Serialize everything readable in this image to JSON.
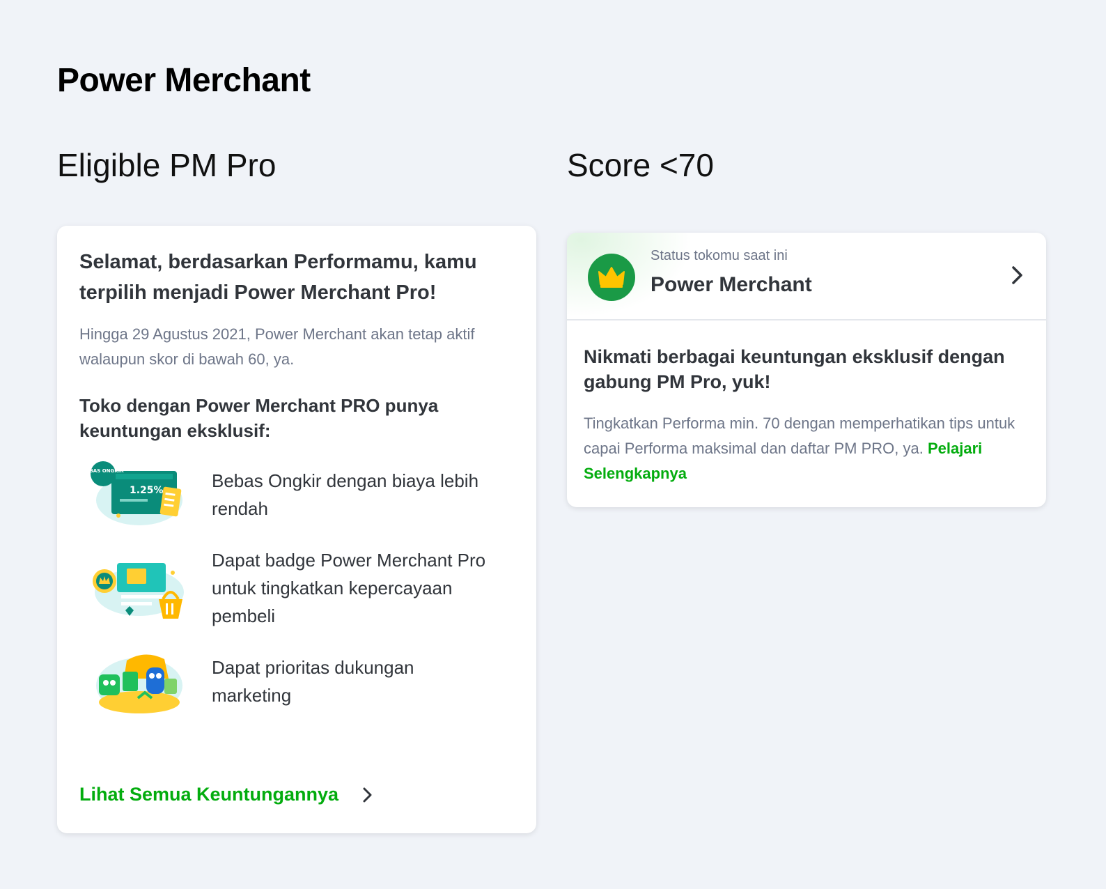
{
  "page_title": "Power Merchant",
  "columns": {
    "left_heading": "Eligible PM Pro",
    "right_heading": "Score <70"
  },
  "eligible_card": {
    "title": "Selamat, berdasarkan Performamu, kamu terpilih menjadi Power Merchant Pro!",
    "subtitle": "Hingga 29 Agustus 2021, Power Merchant akan tetap aktif walaupun skor di bawah 60, ya.",
    "benefits_heading": "Toko dengan Power Merchant PRO punya keuntungan eksklusif:",
    "benefits": [
      {
        "icon": "free-shipping-illustration",
        "text": "Bebas Ongkir dengan biaya lebih rendah",
        "badge_text": "BEBAS ONGKIR",
        "badge_value": "1.25%"
      },
      {
        "icon": "shop-badge-illustration",
        "text": "Dapat badge Power Merchant Pro untuk tingkatkan kepercayaan pembeli"
      },
      {
        "icon": "marketing-priority-illustration",
        "text": "Dapat prioritas dukungan marketing"
      }
    ],
    "see_all_label": "Lihat Semua Keuntungannya"
  },
  "score_card": {
    "status_label": "Status tokomu saat ini",
    "status_value": "Power Merchant",
    "title": "Nikmati berbagai keuntungan eksklusif dengan gabung PM Pro, yuk!",
    "description": "Tingkatkan Performa min. 70 dengan memperhatikan tips untuk capai Performa maksimal dan daftar PM PRO, ya.",
    "link_label": "Pelajari Selengkapnya"
  },
  "colors": {
    "background": "#f0f3f8",
    "accent_green": "#03ac0e",
    "badge_green": "#1a9a46",
    "crown_yellow": "#ffc400",
    "text_dark": "#31353b",
    "text_muted": "#6d7588"
  }
}
